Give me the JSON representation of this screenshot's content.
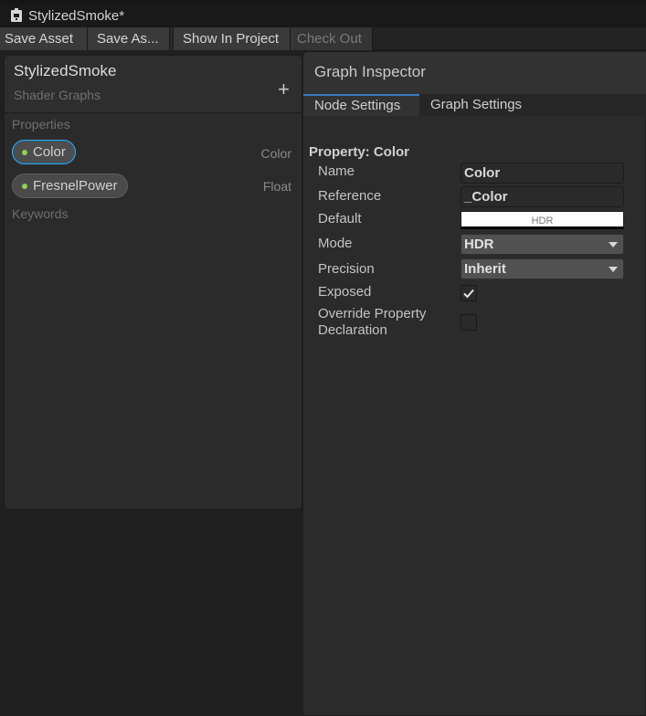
{
  "window": {
    "title": "StylizedSmoke*",
    "icon": "shader-file-icon"
  },
  "toolbar": {
    "save_asset": "Save Asset",
    "save_as": "Save As...",
    "show_in_project": "Show In Project",
    "check_out": "Check Out"
  },
  "blackboard": {
    "title": "StylizedSmoke",
    "subtitle": "Shader Graphs",
    "add_icon": "plus-icon",
    "properties_label": "Properties",
    "properties": [
      {
        "name": "Color",
        "type": "Color",
        "selected": true
      },
      {
        "name": "FresnelPower",
        "type": "Float",
        "selected": false
      }
    ],
    "keywords_label": "Keywords"
  },
  "inspector": {
    "title": "Graph Inspector",
    "tabs": [
      {
        "label": "Node Settings",
        "active": true
      },
      {
        "label": "Graph Settings",
        "active": false
      }
    ],
    "heading": "Property: Color",
    "fields": {
      "name": {
        "label": "Name",
        "value": "Color"
      },
      "reference": {
        "label": "Reference",
        "value": "_Color"
      },
      "default": {
        "label": "Default",
        "swatch_color": "#ffffff",
        "badge": "HDR"
      },
      "mode": {
        "label": "Mode",
        "value": "HDR"
      },
      "precision": {
        "label": "Precision",
        "value": "Inherit"
      },
      "exposed": {
        "label": "Exposed",
        "checked": true
      },
      "override": {
        "label_line1": "Override Property",
        "label_line2": "Declaration",
        "checked": false
      }
    }
  },
  "colors": {
    "accent": "#46a7e0",
    "tab_accent": "#3a79bb",
    "property_dot": "#8fcf5a"
  }
}
